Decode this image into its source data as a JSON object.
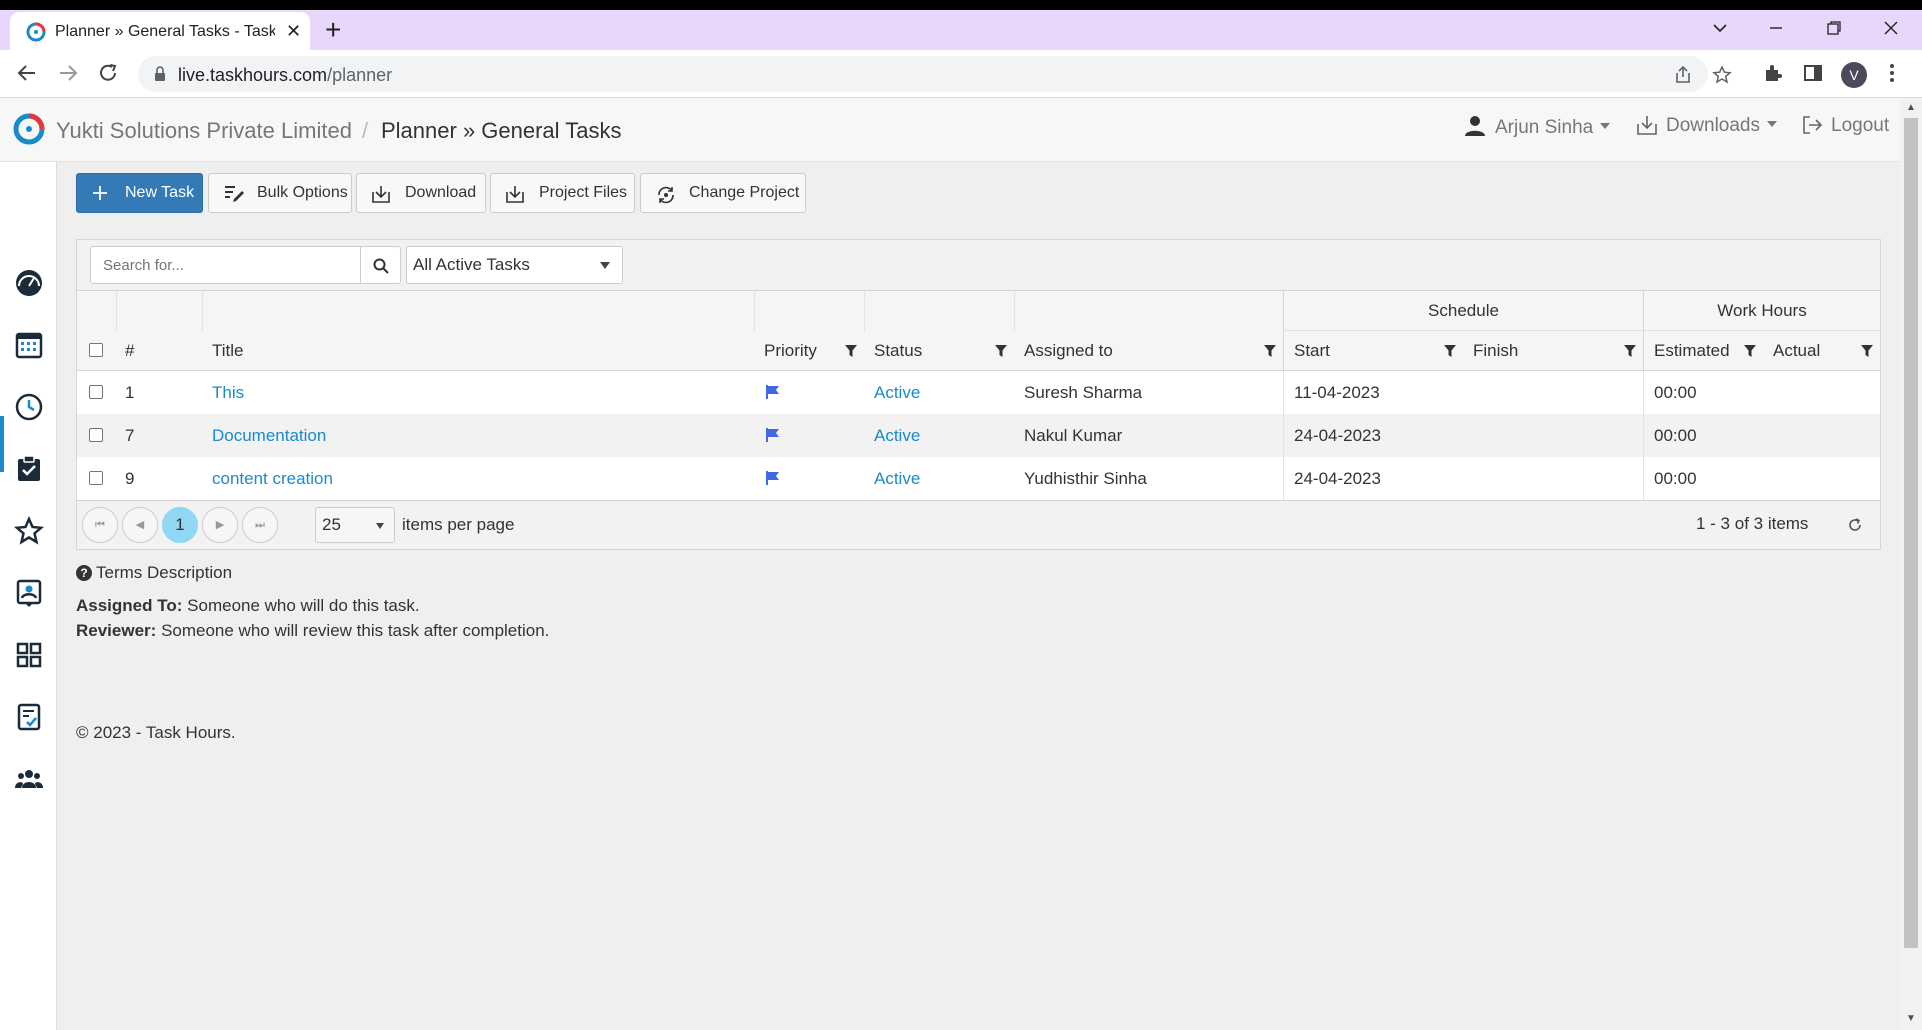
{
  "browser": {
    "tab_title": "Planner » General Tasks - Task Hours",
    "url_domain": "live.taskhours.com",
    "url_path": "/planner",
    "profile_initial": "V"
  },
  "header": {
    "company": "Yukti Solutions Private Limited",
    "separator": "/",
    "page_title": "Planner » General Tasks",
    "user_name": "Arjun Sinha",
    "downloads_label": "Downloads",
    "logout_label": "Logout"
  },
  "sidebar": {
    "items": [
      "dashboard-icon",
      "calendar-icon",
      "clock-icon",
      "tasks-icon",
      "star-icon",
      "contact-icon",
      "apps-icon",
      "checklist-icon",
      "team-icon"
    ],
    "active_index": 3
  },
  "actions": {
    "new_task": "New Task",
    "bulk_options": "Bulk Options",
    "download": "Download",
    "project_files": "Project Files",
    "change_project": "Change Project"
  },
  "grid": {
    "search_placeholder": "Search for...",
    "filter_value": "All Active Tasks",
    "group_headers": {
      "schedule": "Schedule",
      "work_hours": "Work Hours"
    },
    "columns": {
      "num": "#",
      "title": "Title",
      "priority": "Priority",
      "status": "Status",
      "assigned": "Assigned to",
      "start": "Start",
      "finish": "Finish",
      "estimated": "Estimated",
      "actual": "Actual"
    },
    "rows": [
      {
        "num": "1",
        "title": "This",
        "status": "Active",
        "assigned": "Suresh Sharma",
        "start": "11-04-2023",
        "finish": "",
        "estimated": "00:00",
        "actual": ""
      },
      {
        "num": "7",
        "title": "Documentation",
        "status": "Active",
        "assigned": "Nakul Kumar",
        "start": "24-04-2023",
        "finish": "",
        "estimated": "00:00",
        "actual": ""
      },
      {
        "num": "9",
        "title": "content creation",
        "status": "Active",
        "assigned": "Yudhisthir Sinha",
        "start": "24-04-2023",
        "finish": "",
        "estimated": "00:00",
        "actual": ""
      }
    ],
    "pager": {
      "current_page": "1",
      "page_size": "25",
      "items_per_page_label": "items per page",
      "info": "1 - 3 of 3 items"
    }
  },
  "terms": {
    "title": "Terms Description",
    "assigned_label": "Assigned To:",
    "assigned_text": "Someone who will do this task.",
    "reviewer_label": "Reviewer:",
    "reviewer_text": "Someone who will review this task after completion."
  },
  "footer": "© 2023 - Task Hours.",
  "colors": {
    "primary": "#337ab7",
    "link": "#1a8ac8",
    "priority_flag": "#4169e1",
    "tabbar": "#e8d7fb",
    "current_page": "#8fd7f2"
  }
}
